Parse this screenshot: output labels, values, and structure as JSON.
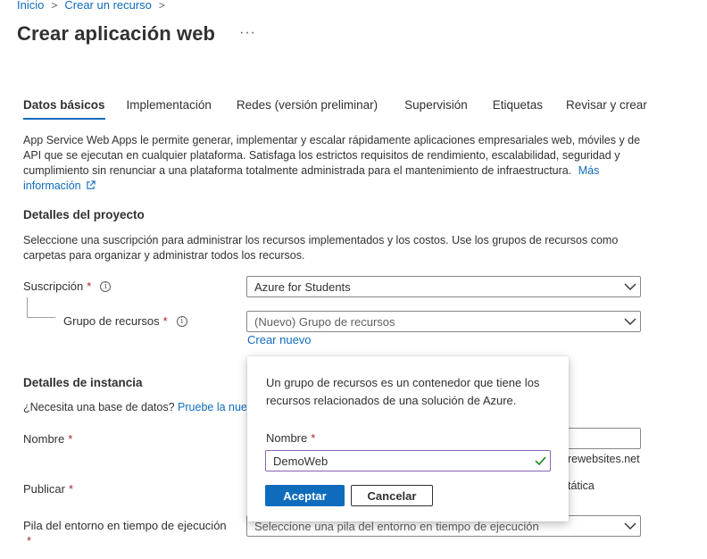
{
  "breadcrumb": {
    "items": [
      "Inicio",
      "Crear un recurso"
    ],
    "sep": ">"
  },
  "page": {
    "title": "Crear aplicación web",
    "more": "···"
  },
  "tabs": [
    "Datos básicos",
    "Implementación",
    "Redes (versión preliminar)",
    "Supervisión",
    "Etiquetas",
    "Revisar y crear"
  ],
  "intro": {
    "text": "App Service Web Apps le permite generar, implementar y escalar rápidamente aplicaciones empresariales web, móviles y de API que se ejecutan en cualquier plataforma. Satisfaga los estrictos requisitos de rendimiento, escalabilidad, seguridad y cumplimiento sin renunciar a una plataforma totalmente administrada para el mantenimiento de infraestructura.",
    "link": "Más información"
  },
  "project": {
    "heading": "Detalles del proyecto",
    "description": "Seleccione una suscripción para administrar los recursos implementados y los costos. Use los grupos de recursos como carpetas para organizar y administrar todos los recursos.",
    "subscription_label": "Suscripción",
    "subscription_value": "Azure for Students",
    "rg_label": "Grupo de recursos",
    "rg_value": "(Nuevo) Grupo de recursos",
    "create_new": "Crear nuevo"
  },
  "instance": {
    "heading": "Detalles de instancia",
    "db_question": "¿Necesita una base de datos?",
    "db_link": "Pruebe la nue",
    "name_label": "Nombre",
    "name_suffix": "rewebsites.net",
    "publish_label": "Publicar",
    "publish_partial": "tática",
    "runtime_label": "Pila del entorno en tiempo de ejecución",
    "runtime_placeholder": "Seleccione una pila del entorno en tiempo de ejecución"
  },
  "required_mark": "*",
  "info_glyph": "i",
  "popup": {
    "text": "Un grupo de recursos es un contenedor que tiene los recursos relacionados de una solución de Azure.",
    "label": "Nombre",
    "value": "DemoWeb",
    "ok": "Aceptar",
    "cancel": "Cancelar"
  },
  "colors": {
    "accent": "#0f6cbd",
    "required": "#a4262c",
    "input_focus": "#8764b8",
    "valid_check": "#107c10"
  }
}
